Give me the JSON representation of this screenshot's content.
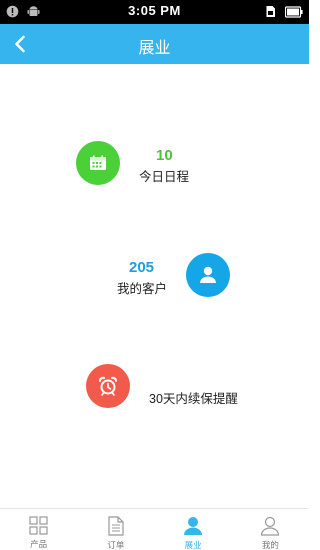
{
  "status_bar": {
    "time": "3:05 PM",
    "left_icons": [
      "notification-icon",
      "android-icon"
    ],
    "right_icons": [
      "sd-card-icon",
      "battery-icon"
    ]
  },
  "header": {
    "title": "展业",
    "back_icon": "chevron-left-icon"
  },
  "features": [
    {
      "count": "10",
      "label": "今日日程",
      "icon": "calendar-icon",
      "color": "#4cd03a",
      "count_color": "#4cc33a"
    },
    {
      "count": "205",
      "label": "我的客户",
      "icon": "person-icon",
      "color": "#14a6e6",
      "count_color": "#1a9fe0"
    },
    {
      "count": "",
      "label": "30天内续保提醒",
      "icon": "alarm-clock-icon",
      "color": "#f25a4c"
    }
  ],
  "tabs": [
    {
      "label": "产品",
      "icon": "grid-icon",
      "active": false
    },
    {
      "label": "订单",
      "icon": "document-icon",
      "active": false
    },
    {
      "label": "展业",
      "icon": "person-icon",
      "active": true
    },
    {
      "label": "我的",
      "icon": "user-outline-icon",
      "active": false
    }
  ],
  "colors": {
    "header_bg": "#35b4ee",
    "active_tab": "#35b4ee",
    "inactive_tab": "#777777"
  }
}
